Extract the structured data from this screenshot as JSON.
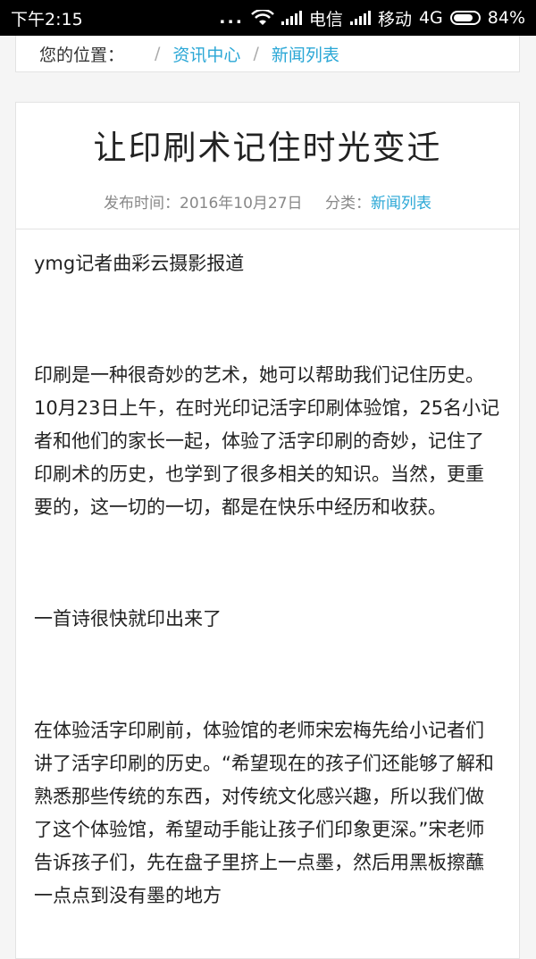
{
  "status_bar": {
    "time": "下午2:15",
    "dots": "...",
    "carrier1": "电信",
    "carrier2": "移动",
    "network": "4G",
    "battery": "84%"
  },
  "breadcrumb": {
    "label": "您的位置：",
    "sep": "/",
    "items": [
      "资讯中心",
      "新闻列表"
    ]
  },
  "article": {
    "title": "让印刷术记住时光变迁",
    "meta": {
      "publish_label": "发布时间：2016年10月27日",
      "category_label": "分类：",
      "category_value": "新闻列表"
    },
    "paragraphs": [
      "ymg记者曲彩云摄影报道",
      "印刷是一种很奇妙的艺术，她可以帮助我们记住历史。10月23日上午，在时光印记活字印刷体验馆，25名小记者和他们的家长一起，体验了活字印刷的奇妙，记住了印刷术的历史，也学到了很多相关的知识。当然，更重要的，这一切的一切，都是在快乐中经历和收获。",
      "一首诗很快就印出来了",
      "在体验活字印刷前，体验馆的老师宋宏梅先给小记者们讲了活字印刷的历史。“希望现在的孩子们还能够了解和熟悉那些传统的东西，对传统文化感兴趣，所以我们做了这个体验馆，希望动手能让孩子们印象更深。”宋老师告诉孩子们，先在盘子里挤上一点墨，然后用黑板擦蘸一点点到没有墨的地方"
    ]
  }
}
